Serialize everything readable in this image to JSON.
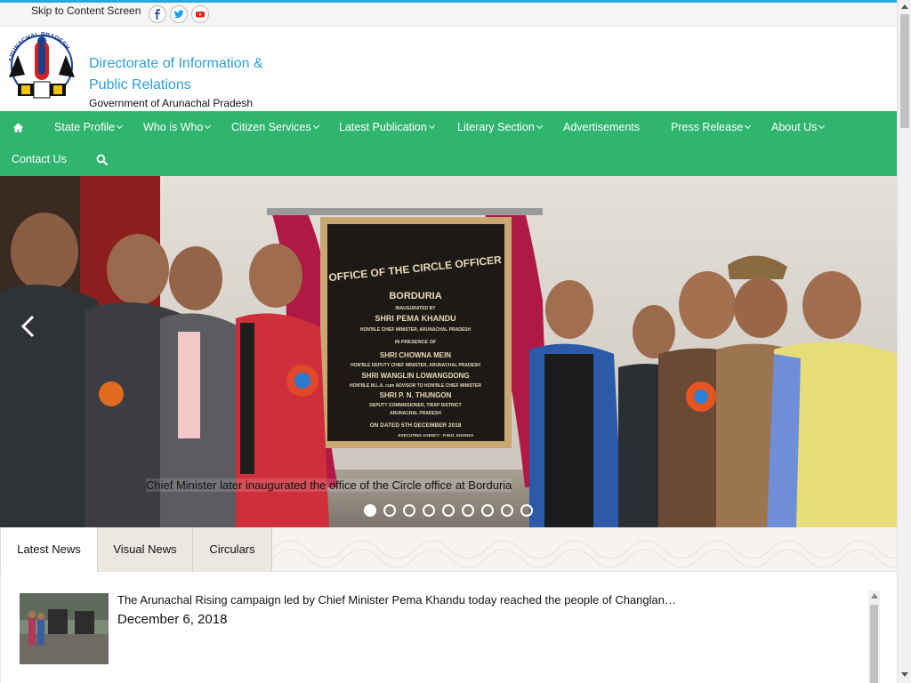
{
  "topbar": {
    "skip_link": "Skip to Content Screen",
    "social": [
      {
        "icon": "facebook-icon",
        "color": "#3b5998"
      },
      {
        "icon": "twitter-icon",
        "color": "#1da1f2"
      },
      {
        "icon": "youtube-icon",
        "color": "#e62117"
      }
    ]
  },
  "header": {
    "title_line1": "Directorate of Information &",
    "title_line2": "Public Relations",
    "subtitle": "Government of Arunachal Pradesh",
    "logo_text": "ARUNACHAL PRADESH"
  },
  "colors": {
    "accent_blue": "#2b9fdc",
    "nav_green": "#2fb56e"
  },
  "nav": {
    "home_icon": "home-icon",
    "items": [
      {
        "label": "State Profile",
        "dropdown": true
      },
      {
        "label": "Who is Who",
        "dropdown": true
      },
      {
        "label": "Citizen Services",
        "dropdown": true
      },
      {
        "label": "Latest Publication",
        "dropdown": true
      },
      {
        "label": "Literary Section",
        "dropdown": true
      },
      {
        "label": "Advertisements",
        "dropdown": false
      },
      {
        "label": "Press Release",
        "dropdown": true
      },
      {
        "label": "About Us",
        "dropdown": true
      },
      {
        "label": "Contact Us",
        "dropdown": false
      }
    ],
    "search_icon": "search-icon"
  },
  "slider": {
    "caption": "Chief Minister later inaugurated the office of the Circle office at Borduria",
    "slide_count": 9,
    "active_index": 0,
    "plaque": {
      "line1": "OFFICE OF THE CIRCLE OFFICER",
      "line2": "BORDURIA",
      "line3": "INAUGURATED BY",
      "line4": "SHRI PEMA KHANDU",
      "line5": "HON'BLE CHIEF MINISTER, ARUNACHAL PRADESH",
      "line6": "IN PRESENCE OF",
      "line7": "SHRI CHOWNA MEIN",
      "line8": "HON'BLE DEPUTY CHIEF MINISTER, ARUNACHAL PRADESH",
      "line9": "SHRI WANGLIN LOWANGDONG",
      "line10": "HON'BLE M.L.A. cum ADVISOR TO HON'BLE CHIEF MINISTER",
      "line11": "SHRI P. N. THUNGON",
      "line12": "DEPUTY COMMISSIONER, TIRAP DISTRICT",
      "line13": "ARUNACHAL PRADESH",
      "line14": "ON DATED 5TH DECEMBER 2018",
      "line15": "EXECUTING AGENCY : P.W.D. KHONSA"
    }
  },
  "tabs": [
    {
      "label": "Latest News",
      "active": true
    },
    {
      "label": "Visual News",
      "active": false
    },
    {
      "label": "Circulars",
      "active": false
    }
  ],
  "news": [
    {
      "text": "The Arunachal Rising campaign led by Chief Minister Pema Khandu today reached the people of Changlan…",
      "date": "December 6, 2018"
    }
  ]
}
